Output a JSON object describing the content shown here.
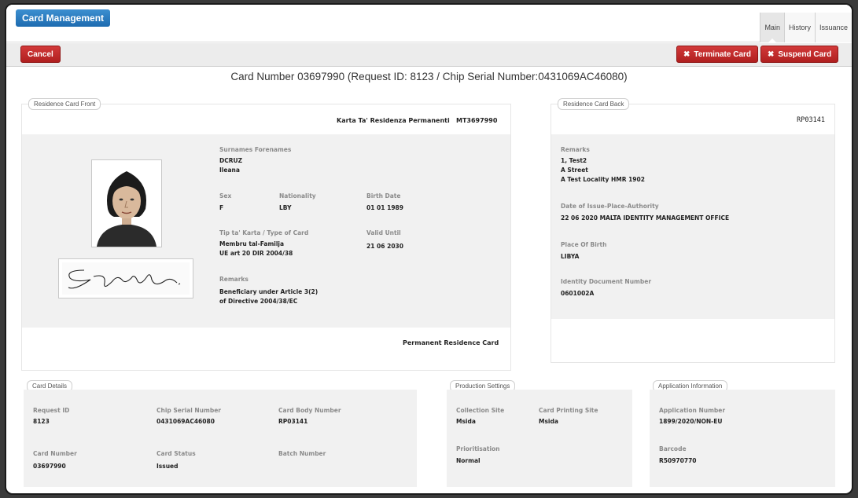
{
  "app": {
    "title": "Card Management"
  },
  "tabs": [
    {
      "label": "Main"
    },
    {
      "label": "History"
    },
    {
      "label": "Issuance"
    }
  ],
  "actions": {
    "cancel": "Cancel",
    "terminate": "Terminate Card",
    "suspend": "Suspend Card"
  },
  "card_header": "Card Number 03697990 (Request ID: 8123 / Chip Serial Number:0431069AC46080)",
  "front": {
    "legend": "Residence Card Front",
    "top_title": "Karta Ta' Residenza Permanenti",
    "top_code": "MT3697990",
    "surnames_label": "Surnames Forenames",
    "surname": "DCRUZ",
    "forename": "Ileana",
    "sex_label": "Sex",
    "sex": "F",
    "nationality_label": "Nationality",
    "nationality": "LBY",
    "birth_label": "Birth Date",
    "birth": "01 01 1989",
    "type_label": "Tip ta' Karta / Type of Card",
    "type_line1": "Membru tal-Familja",
    "type_line2": "UE art 20 DIR 2004/38",
    "valid_label": "Valid Until",
    "valid": "21 06 2030",
    "remarks_label": "Remarks",
    "remarks_line1": "Beneficiary under Article 3(2)",
    "remarks_line2": "of Directive 2004/38/EC",
    "footer": "Permanent Residence Card"
  },
  "back": {
    "legend": "Residence Card Back",
    "code": "RP03141",
    "remarks_label": "Remarks",
    "remarks_line1": "1, Test2",
    "remarks_line2": "A Street",
    "remarks_line3": "A Test Locality HMR 1902",
    "issue_label": "Date of Issue-Place-Authority",
    "issue": "22 06 2020 MALTA IDENTITY MANAGEMENT OFFICE",
    "pob_label": "Place Of Birth",
    "pob": "LIBYA",
    "idn_label": "Identity Document Number",
    "idn": "0601002A"
  },
  "card_details": {
    "legend": "Card Details",
    "request_id_label": "Request ID",
    "request_id": "8123",
    "chip_label": "Chip Serial Number",
    "chip": "0431069AC46080",
    "body_label": "Card Body Number",
    "body": "RP03141",
    "number_label": "Card Number",
    "number": "03697990",
    "status_label": "Card Status",
    "status": "Issued",
    "batch_label": "Batch Number",
    "batch": ""
  },
  "production": {
    "legend": "Production Settings",
    "collection_label": "Collection Site",
    "collection": "Msida",
    "printing_label": "Card Printing Site",
    "printing": "Msida",
    "priority_label": "Prioritisation",
    "priority": "Normal"
  },
  "application": {
    "legend": "Application Information",
    "number_label": "Application Number",
    "number": "1899/2020/NON-EU",
    "barcode_label": "Barcode",
    "barcode": "R50970770"
  },
  "colors": {
    "accent_blue": "#1d6bb0",
    "danger_red": "#c0272d",
    "panel_grey": "#f1f1f1"
  }
}
